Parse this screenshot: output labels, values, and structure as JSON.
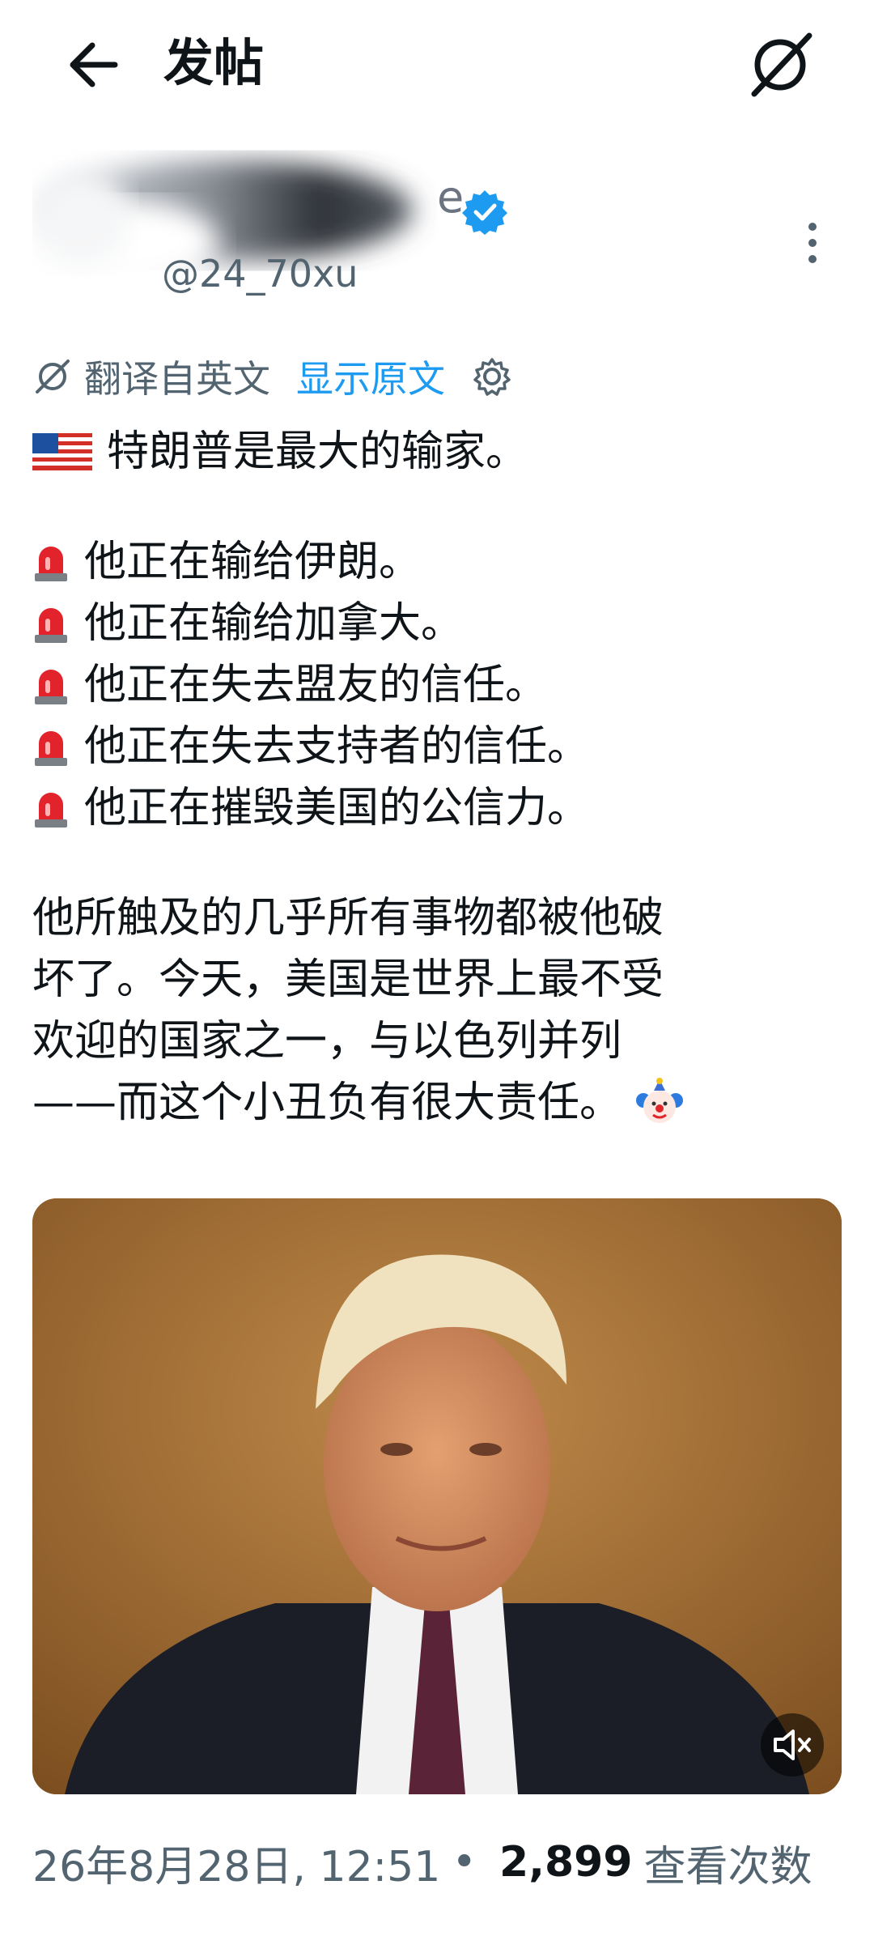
{
  "header": {
    "title": "发帖"
  },
  "author": {
    "name_visible_tail": "e",
    "handle_visible": "@24_70xu"
  },
  "translation": {
    "label": "翻译自英文",
    "show_original": "显示原文"
  },
  "post": {
    "headline": "特朗普是最大的输家。",
    "bullets": [
      "他正在输给伊朗。",
      "他正在输给加拿大。",
      "他正在失去盟友的信任。",
      "他正在失去支持者的信任。",
      "他正在摧毁美国的公信力。"
    ],
    "paragraph_lines": [
      "他所触及的几乎所有事物都被他破",
      "坏了。今天，美国是世界上最不受",
      "欢迎的国家之一，与以色列并列",
      "——而这个小丑负有很大责任。"
    ]
  },
  "meta": {
    "datetime": "26年8月28日, 12:51",
    "separator": "•",
    "views": "2,899",
    "views_label": "查看次数"
  },
  "colors": {
    "link_blue": "#1d9bf0",
    "text": "#0f1419",
    "muted": "#536471"
  },
  "icons": [
    "back-arrow-icon",
    "grok-icon",
    "verified-badge-icon",
    "more-icon",
    "translate-icon",
    "gear-icon",
    "us-flag-icon",
    "siren-icon",
    "clown-icon",
    "mute-icon"
  ]
}
